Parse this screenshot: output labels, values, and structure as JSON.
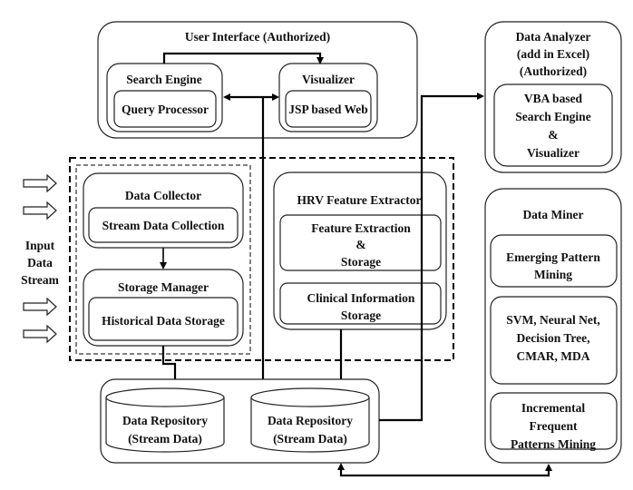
{
  "user_interface": {
    "title": "User Interface (Authorized)",
    "search_engine": {
      "title": "Search Engine",
      "inner": "Query Processor"
    },
    "visualizer": {
      "title": "Visualizer",
      "inner": "JSP based Web"
    }
  },
  "input": {
    "lines": [
      "Input",
      "Data",
      "Stream"
    ]
  },
  "data_collector": {
    "title": "Data Collector",
    "inner": "Stream Data Collection"
  },
  "storage_manager": {
    "title": "Storage Manager",
    "inner": "Historical Data Storage"
  },
  "hrv": {
    "title": "HRV Feature Extractor",
    "feature": [
      "Feature Extraction",
      "&",
      "Storage"
    ],
    "clinical": [
      "Clinical Information",
      "Storage"
    ]
  },
  "repositories": [
    {
      "lines": [
        "Data Repository",
        "(Stream Data)"
      ]
    },
    {
      "lines": [
        "Data Repository",
        "(Stream Data)"
      ]
    }
  ],
  "data_analyzer": {
    "title": [
      "Data Analyzer",
      "(add in Excel)",
      "(Authorized)"
    ],
    "inner": [
      "VBA based",
      "Search Engine",
      "&",
      "Visualizer"
    ]
  },
  "data_miner": {
    "title": "Data Miner",
    "emerging": [
      "Emerging Pattern",
      "Mining"
    ],
    "classifiers": [
      "SVM, Neural Net,",
      "Decision Tree,",
      "CMAR, MDA"
    ],
    "incremental": [
      "Incremental",
      "Frequent",
      "Patterns Mining"
    ]
  }
}
